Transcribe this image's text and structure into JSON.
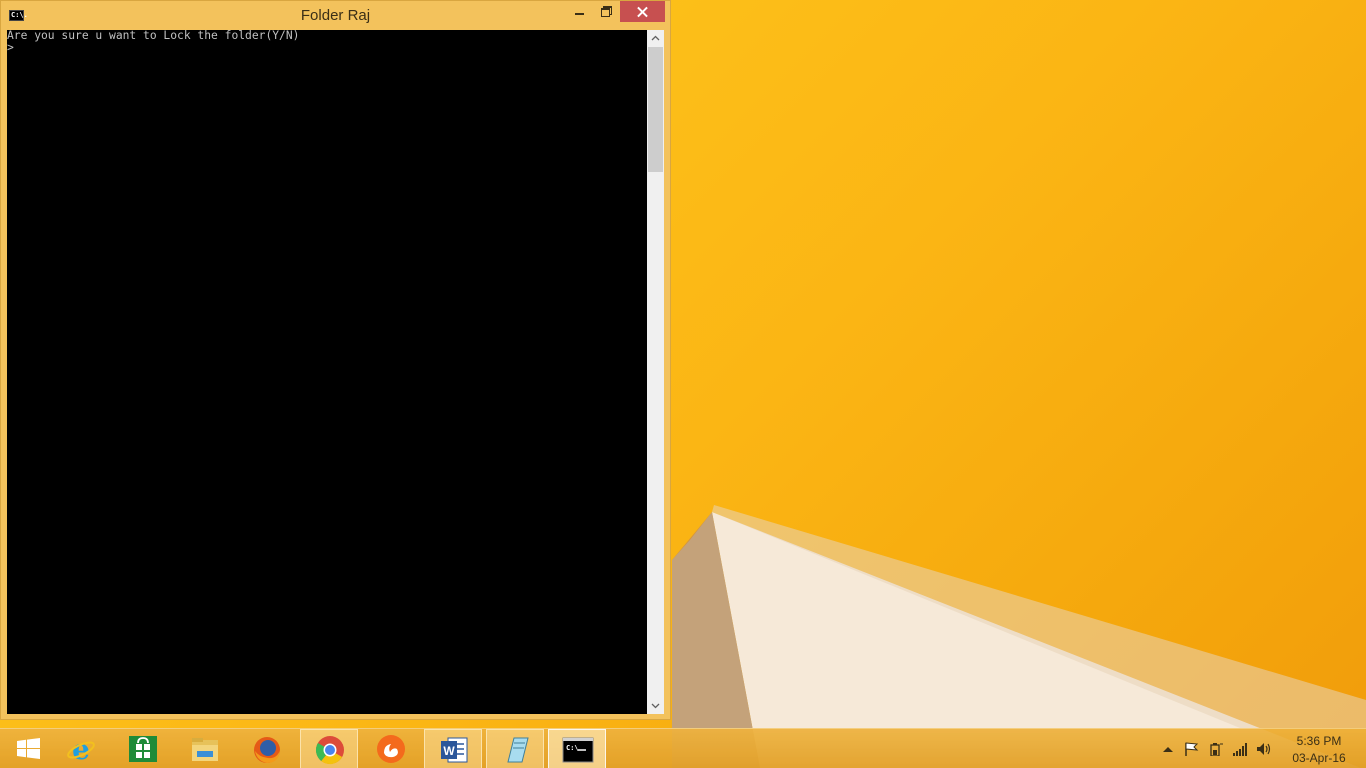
{
  "window": {
    "title": "Folder Raj",
    "icon_name": "console-icon",
    "icon_text": "C:\\."
  },
  "console": {
    "lines": [
      "Are you sure u want to Lock the folder(Y/N)",
      ">"
    ]
  },
  "taskbar": {
    "items": [
      {
        "name": "start-icon"
      },
      {
        "name": "internet-explorer-icon"
      },
      {
        "name": "store-icon"
      },
      {
        "name": "file-explorer-icon"
      },
      {
        "name": "firefox-icon"
      },
      {
        "name": "chrome-icon",
        "state": "running"
      },
      {
        "name": "uc-browser-icon"
      },
      {
        "name": "word-icon",
        "state": "running"
      },
      {
        "name": "notepad-icon",
        "state": "running"
      },
      {
        "name": "command-prompt-icon",
        "state": "focused"
      }
    ],
    "tray": {
      "icons": [
        "show-hidden-icons-icon",
        "action-center-flag-icon",
        "power-icon",
        "network-signal-icon",
        "volume-icon"
      ],
      "time": "5:36 PM",
      "date": "03-Apr-16"
    }
  },
  "colors": {
    "window_frame": "#f3c25c",
    "close_button": "#c75050",
    "console_bg": "#000000",
    "console_text": "#c0c0c0",
    "desktop": "#fbbb12"
  }
}
